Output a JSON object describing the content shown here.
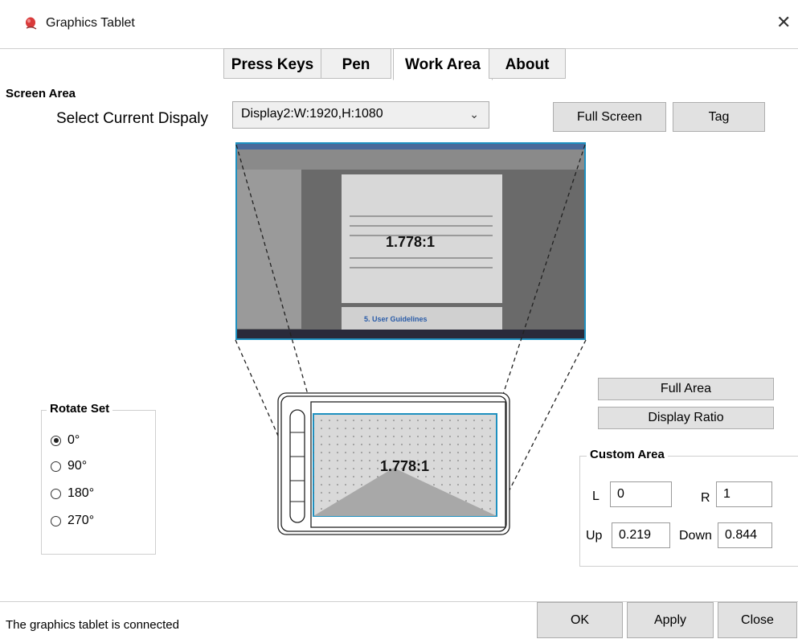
{
  "window": {
    "title": "Graphics Tablet",
    "close_glyph": "✕"
  },
  "tabs": [
    {
      "label": "Press Keys",
      "active": false
    },
    {
      "label": "Pen",
      "active": false
    },
    {
      "label": "Work Area",
      "active": true
    },
    {
      "label": "About",
      "active": false
    }
  ],
  "screen_area": {
    "label": "Screen Area",
    "select_label": "Select Current Dispaly",
    "selected_display": "Display2:W:1920,H:1080",
    "full_screen_label": "Full Screen",
    "tag_label": "Tag",
    "ratio": "1.778:1"
  },
  "preview": {
    "doc_heading": "5. User Guidelines"
  },
  "tablet": {
    "ratio": "1.778:1",
    "full_area_label": "Full Area",
    "display_ratio_label": "Display Ratio"
  },
  "rotate_set": {
    "label": "Rotate Set",
    "options": [
      "0°",
      "90°",
      "180°",
      "270°"
    ],
    "selected": "0°"
  },
  "custom_area": {
    "label": "Custom Area",
    "l_label": "L",
    "l_value": "0",
    "r_label": "R",
    "r_value": "1",
    "up_label": "Up",
    "up_value": "0.219",
    "down_label": "Down",
    "down_value": "0.844"
  },
  "status": {
    "text": "The graphics tablet is connected"
  },
  "footer": {
    "ok_label": "OK",
    "apply_label": "Apply",
    "close_label": "Close"
  },
  "colors": {
    "accent_border": "#1e90c0",
    "button_bg": "#e1e1e1",
    "tab_bg": "#f0f0f0"
  },
  "icons": {
    "app": "pen-app-icon",
    "dropdown": "chevron-down-icon",
    "close": "close-icon"
  }
}
